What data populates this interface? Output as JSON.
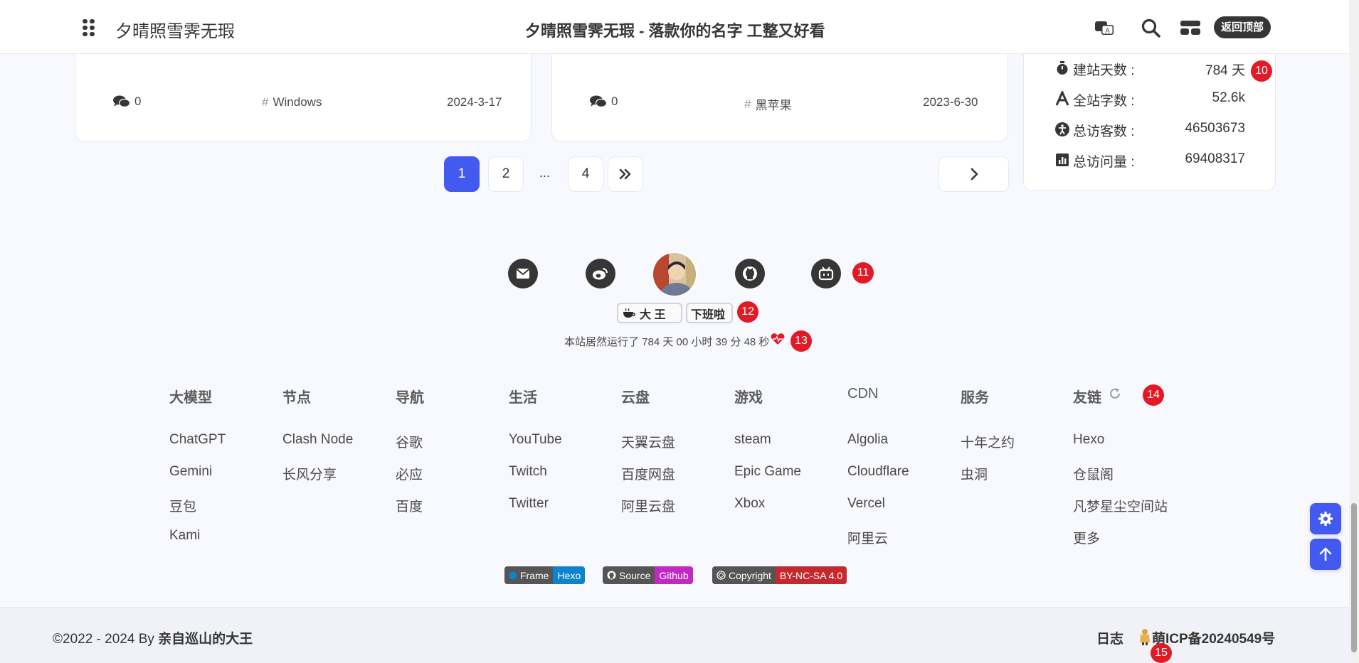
{
  "navbar": {
    "site_name": "夕晴照雪霁无瑕",
    "page_title": "夕晴照雪霁无瑕 - 落款你的名字 工整又好看",
    "back_top_label": "返回顶部",
    "icons": [
      "menu-grid-icon",
      "translate-icon",
      "search-icon",
      "console-icon"
    ]
  },
  "posts": [
    {
      "comments": "0",
      "tag": "Windows",
      "date": "2024-3-17"
    },
    {
      "comments": "0",
      "tag": "黑苹果",
      "date": "2023-6-30"
    }
  ],
  "pagination": {
    "pages": [
      "1",
      "2",
      "4"
    ],
    "ellipsis": "...",
    "current": "1"
  },
  "site_stats": [
    {
      "icon": "stopwatch-icon",
      "label": "建站天数 :",
      "value": "784 天"
    },
    {
      "icon": "font-icon",
      "label": "全站字数 :",
      "value": "52.6k"
    },
    {
      "icon": "accessibility-icon",
      "label": "总访客数 :",
      "value": "46503673"
    },
    {
      "icon": "bar-chart-icon",
      "label": "总访问量 :",
      "value": "69408317"
    }
  ],
  "markers": [
    "10",
    "11",
    "12",
    "13",
    "14",
    "15"
  ],
  "social": {
    "icons": [
      "email-icon",
      "weibo-icon",
      "github-icon",
      "bilibili-icon"
    ],
    "author_tag": "大 王",
    "status_tag": "下班啦",
    "runtime_text": "本站居然运行了 784 天 00 小时 39 分 48 秒"
  },
  "footer_groups": [
    {
      "title": "大模型",
      "links": [
        "ChatGPT",
        "Gemini",
        "豆包",
        "Kami"
      ]
    },
    {
      "title": "节点",
      "links": [
        "Clash Node",
        "长风分享"
      ]
    },
    {
      "title": "导航",
      "links": [
        "谷歌",
        "必应",
        "百度"
      ]
    },
    {
      "title": "生活",
      "links": [
        "YouTube",
        "Twitch",
        "Twitter"
      ]
    },
    {
      "title": "云盘",
      "links": [
        "天翼云盘",
        "百度网盘",
        "阿里云盘"
      ]
    },
    {
      "title": "游戏",
      "links": [
        "steam",
        "Epic Game",
        "Xbox"
      ]
    },
    {
      "title": "CDN",
      "links": [
        "Algolia",
        "Cloudflare",
        "Vercel",
        "阿里云"
      ]
    },
    {
      "title": "服务",
      "links": [
        "十年之约",
        "虫洞"
      ]
    },
    {
      "title": "友链",
      "links": [
        "Hexo",
        "仓鼠阁",
        "凡梦星尘空间站",
        "更多"
      ]
    }
  ],
  "badges": [
    {
      "left": "Frame",
      "right": "Hexo",
      "color": "#0e83cd"
    },
    {
      "left": "Source",
      "right": "Github",
      "color": "#c228c2"
    },
    {
      "left": "Copyright",
      "right": "BY-NC-SA 4.0",
      "color": "#c3292e"
    }
  ],
  "bottom": {
    "copyright_prefix": "©2022 - 2024 By ",
    "author": "亲自巡山的大王",
    "log_label": "日志",
    "icp": "萌ICP备20240549号"
  },
  "colors": {
    "accent": "#425aef",
    "marker": "#e21a26",
    "dark": "#363636"
  }
}
